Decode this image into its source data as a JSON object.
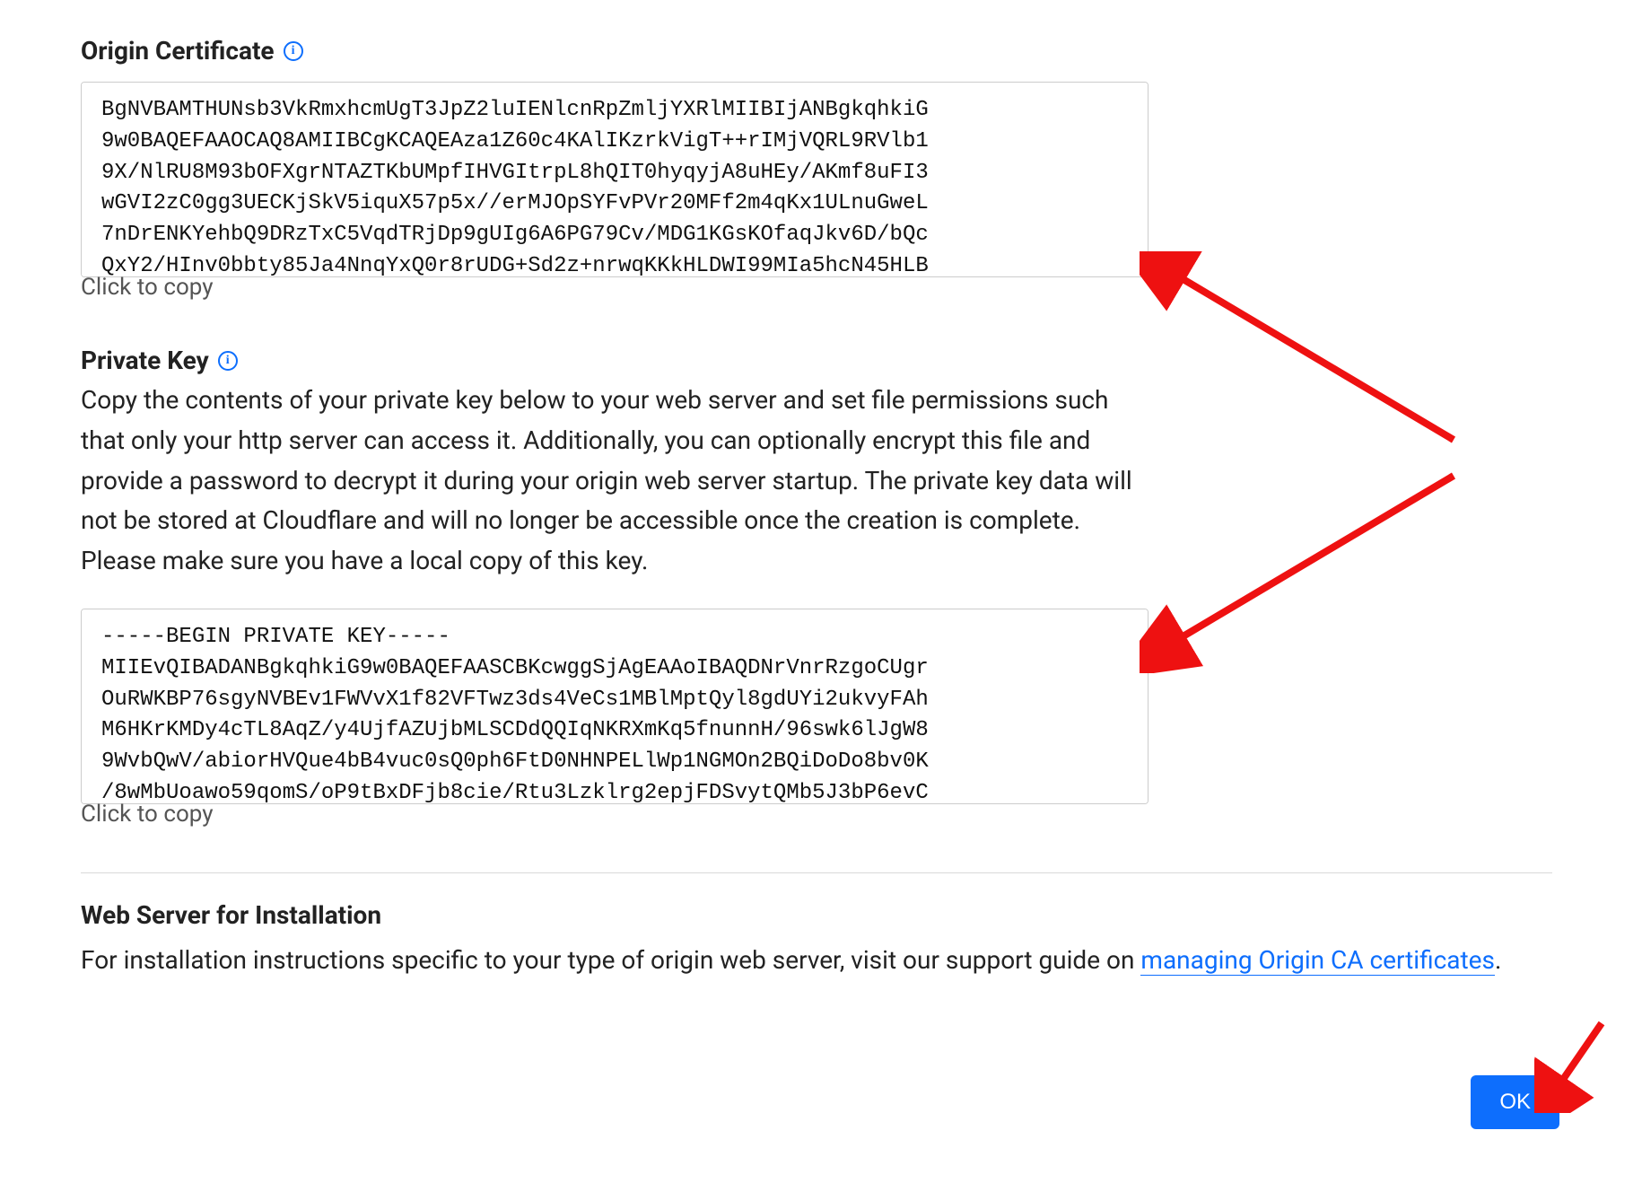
{
  "origin_cert": {
    "title": "Origin Certificate",
    "code": "BgNVBAMTHUNsb3VkRmxhcmUgT3JpZ2luIENlcnRpZmljYXRlMIIBIjANBgkqhkiG\n9w0BAQEFAAOCAQ8AMIIBCgKCAQEAza1Z60c4KAlIKzrkVigT++rIMjVQRL9RVlb1\n9X/NlRU8M93bOFXgrNTAZTKbUMpfIHVGItrpL8hQIT0hyqyjA8uHEy/AKmf8uFI3\nwGVI2zC0gg3UECKjSkV5iquX57p5x//erMJOpSYFvPVr20MFf2m4qKx1ULnuGweL\n7nDrENKYehbQ9DRzTxC5VqdTRjDp9gUIg6A6PG79Cv/MDG1KGsKOfaqJkv6D/bQc\nQxY2/HInv0bbty85Ja4NnqYxQ0r8rUDG+Sd2z+nrwqKKkHLDWI99MIa5hcN45HLB",
    "copy_label": "Click to copy"
  },
  "private_key": {
    "title": "Private Key",
    "description": "Copy the contents of your private key below to your web server and set file permissions such that only your http server can access it. Additionally, you can optionally encrypt this file and provide a password to decrypt it during your origin web server startup. The private key data will not be stored at Cloudflare and will no longer be accessible once the creation is complete. Please make sure you have a local copy of this key.",
    "code": "-----BEGIN PRIVATE KEY-----\nMIIEvQIBADANBgkqhkiG9w0BAQEFAASCBKcwggSjAgEAAoIBAQDNrVnrRzgoCUgr\nOuRWKBP76sgyNVBEv1FWVvX1f82VFTwz3ds4VeCs1MBlMptQyl8gdUYi2ukvyFAh\nM6HKrKMDy4cTL8AqZ/y4UjfAZUjbMLSCDdQQIqNKRXmKq5fnunnH/96swk6lJgW8\n9WvbQwV/abiorHVQue4bB4vuc0sQ0ph6FtD0NHNPELlWp1NGMOn2BQiDoDo8bv0K\n/8wMbUoawo59qomS/oP9tBxDFjb8cie/Rtu3Lzklrg2epjFDSvytQMb5J3bP6evC",
    "copy_label": "Click to copy"
  },
  "install": {
    "heading": "Web Server for Installation",
    "text_prefix": "For installation instructions specific to your type of origin web server, visit our support guide on ",
    "link_text": "managing Origin CA certificates",
    "text_suffix": "."
  },
  "buttons": {
    "ok": "OK"
  }
}
